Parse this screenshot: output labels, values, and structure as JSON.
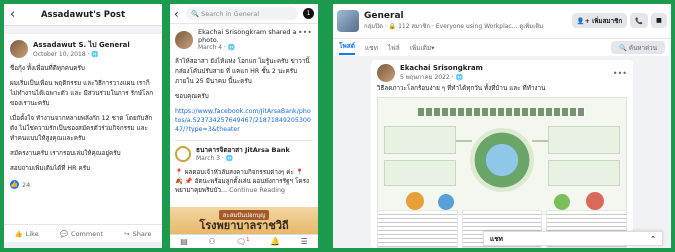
{
  "panel1": {
    "back_icon": "back-arrow-icon",
    "header_title": "Assadawut's Post",
    "author": "Assadawut S. ไป General",
    "timestamp": "October 10, 2018 · ",
    "body": [
      "ชื่อกุ้ง ทั้งเพื่อนที่ดีทุกคนครับ",
      "ผมเริ่มเป็นเพื่อน พฤติกรรม และวิธีการวางแผน เราก็ไม่ทำงานได้เฉพาะตัว และ มีส่วนร่วมในการ รักษ์โลก ของเรานะครับ",
      "เมื่อตั้งใจ ทำงานจากหลายพลังกัก 12 ชาด โดยกับสักตัง ไม่ใช่ความรักเป็นชองสมัครตัวร่วมกิจกรรม และ ทำคนแบบให้สูงคุณและครับ",
      "สมัครงานครับ เรากรอบเล่มให้คุณอยู่ครับ",
      "สอบถามเพิ่มเติมได้ที่ HR ครับ"
    ],
    "reaction_count": "24",
    "actions": {
      "like": "Like",
      "comment": "Comment",
      "share": "Share"
    }
  },
  "panel2": {
    "search_placeholder": "Search in General",
    "badge": "1",
    "author": "Ekachai Srisongkram shared a photo.",
    "timestamp": "March 4 · ",
    "body": "ล้าไห้สอาสา ยังไห้แห่ง โอกแก ไมรู้นะครับ ข่าวานิ้กล่องโคันปรับสาย ที่ แคแก HR ชั้น 2 นะครับ ภายใน 25 มีนาคม นี้นะครับ",
    "thanks": "ขอบคุณครับ",
    "link": "https://www.facebook.com/JitArsaBank/photos/a.523734257649467/2187184920530047/?type=3&theater",
    "shared_author": "ธนาคารจิตอาสา JitArsa Bank",
    "shared_time": "March 3 · ",
    "shared_text": "📍 ผลตอบเจ้าหัวลับสงคามกิจกรรมต่างๆ ค่ะ 📍",
    "shared_text2": "🍂 📌 อัตนะพร้อมลูกตั้งเล่น ผอนพังการรัฐฯ โครงพยามาคุยพริบบัว...",
    "continue_label": "Continue Reading",
    "thumb_tag": "สะสมปันปอกบุญ",
    "thumb_title": "โรงพยาบาลราชวิถี",
    "nav_icons": [
      "home-icon",
      "group-icon",
      "notifications-icon",
      "bell-icon",
      "menu-icon"
    ],
    "nav_badge": "1"
  },
  "panel3": {
    "group_name": "General",
    "group_sub": "กลุ่มปิด · 🔒 112 สมาชิก · Everyone using Workplac... ดูเพิ่มเติม",
    "btn_member": "เพิ่มสมาชิก",
    "tabs": [
      "โพสต์",
      "แชท",
      "ไฟล์",
      "เพิ่มเติม▾"
    ],
    "search_label": "ค้นหาด่วน",
    "post_author": "Ekachai Srisongkram",
    "post_time": "5 พฤษภาคม 2022 · ",
    "post_text": "วิธีลดภาวะโลกร้อนง่าย ๆ ที่ทำได้ทุกวัน ทั้งที่บ้าน และ ที่ทำงาน",
    "chat_label": "แชท"
  }
}
